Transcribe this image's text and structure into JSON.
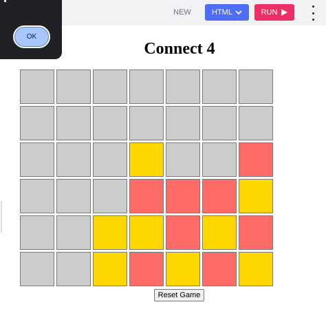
{
  "toolbar": {
    "new_label": "NEW",
    "html_label": "HTML",
    "run_label": "RUN",
    "html_button_color": "#4f6ef7",
    "run_button_color": "#ee2f67"
  },
  "dialog": {
    "ok_label": "OK"
  },
  "game": {
    "title": "Connect 4",
    "reset_label": "Reset Game",
    "colors": {
      "empty": "#cccccc",
      "red": "#ff6b66",
      "yellow": "#ffd700"
    },
    "board": [
      [
        "empty",
        "empty",
        "empty",
        "empty",
        "empty",
        "empty",
        "empty"
      ],
      [
        "empty",
        "empty",
        "empty",
        "empty",
        "empty",
        "empty",
        "empty"
      ],
      [
        "empty",
        "empty",
        "empty",
        "yellow",
        "empty",
        "empty",
        "red"
      ],
      [
        "empty",
        "empty",
        "empty",
        "red",
        "red",
        "red",
        "yellow"
      ],
      [
        "empty",
        "empty",
        "yellow",
        "yellow",
        "red",
        "yellow",
        "red"
      ],
      [
        "empty",
        "empty",
        "yellow",
        "red",
        "yellow",
        "red",
        "yellow"
      ]
    ]
  }
}
